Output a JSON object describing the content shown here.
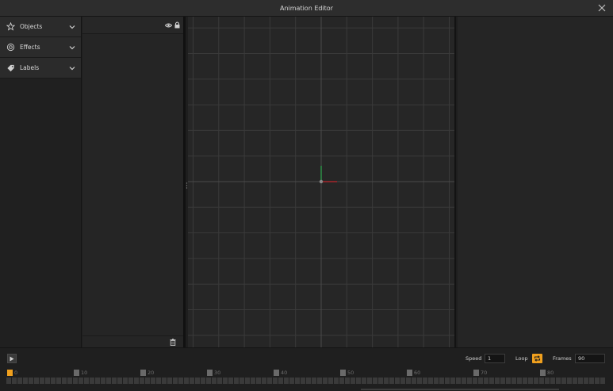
{
  "window": {
    "title": "Animation Editor"
  },
  "categories": [
    {
      "label": "Objects",
      "icon": "star-icon"
    },
    {
      "label": "Effects",
      "icon": "effects-icon"
    },
    {
      "label": "Labels",
      "icon": "tag-icon"
    }
  ],
  "timeline": {
    "speed_label": "Speed",
    "speed_value": "1",
    "loop_label": "Loop",
    "loop_enabled": true,
    "frames_label": "Frames",
    "frames_value": "90",
    "ruler_numbers": [
      "0",
      "10",
      "20",
      "30",
      "40",
      "50",
      "60",
      "70",
      "80"
    ],
    "current_frame": 0
  },
  "colors": {
    "accent": "#f0a01e",
    "axis_x": "#c0272d",
    "axis_y": "#2fa84f"
  }
}
